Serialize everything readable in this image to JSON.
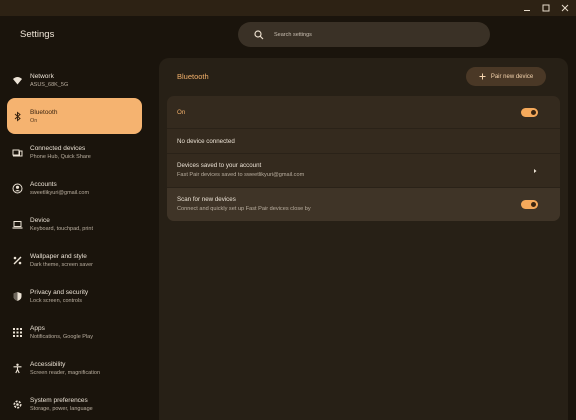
{
  "window": {
    "controls": {
      "minimize": "minimize-icon",
      "maximize": "maximize-icon",
      "close": "close-icon"
    }
  },
  "app": {
    "title": "Settings"
  },
  "search": {
    "placeholder": "Search settings",
    "icon": "search-icon"
  },
  "sidebar": {
    "items": [
      {
        "label": "Network",
        "sub": "ASUS_68K_5G",
        "icon": "wifi-icon"
      },
      {
        "label": "Bluetooth",
        "sub": "On",
        "icon": "bluetooth-icon"
      },
      {
        "label": "Connected devices",
        "sub": "Phone Hub, Quick Share",
        "icon": "connected-devices-icon"
      },
      {
        "label": "Accounts",
        "sub": "sweetlikyuri@gmail.com",
        "icon": "account-icon"
      },
      {
        "label": "Device",
        "sub": "Keyboard, touchpad, print",
        "icon": "laptop-icon"
      },
      {
        "label": "Wallpaper and style",
        "sub": "Dark theme, screen saver",
        "icon": "palette-icon"
      },
      {
        "label": "Privacy and security",
        "sub": "Lock screen, controls",
        "icon": "shield-icon"
      },
      {
        "label": "Apps",
        "sub": "Notifications, Google Play",
        "icon": "apps-grid-icon"
      },
      {
        "label": "Accessibility",
        "sub": "Screen reader, magnification",
        "icon": "accessibility-icon"
      },
      {
        "label": "System preferences",
        "sub": "Storage, power, language",
        "icon": "gear-icon"
      }
    ]
  },
  "bluetooth": {
    "title": "Bluetooth",
    "pair_button": "Pair new device",
    "on_label": "On",
    "on_toggle": true,
    "no_device": "No device connected",
    "saved_title": "Devices saved to your account",
    "saved_sub": "Fast Pair devices saved to sweetlikyuri@gmail.com",
    "scan_title": "Scan for new devices",
    "scan_sub": "Connect and quickly set up Fast Pair devices close by",
    "scan_toggle": true
  },
  "colors": {
    "accent": "#f5b370",
    "background": "#1a140c",
    "panel": "#272016",
    "card": "#342a1e"
  }
}
